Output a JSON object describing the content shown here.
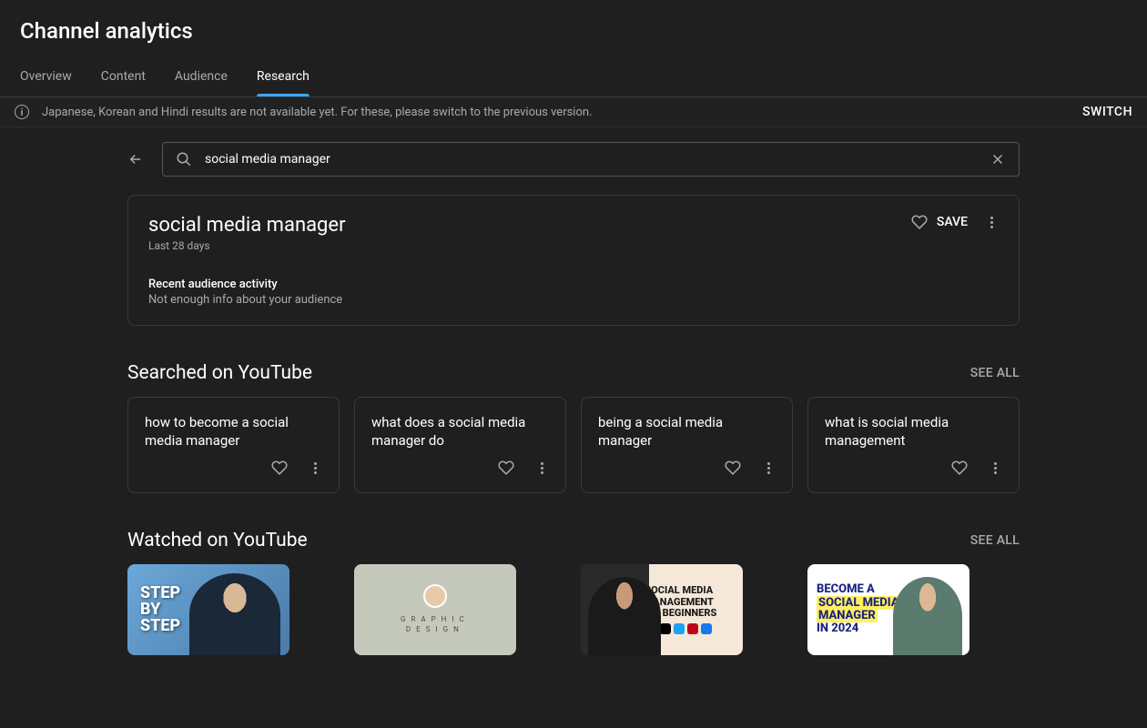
{
  "page_title": "Channel analytics",
  "tabs": [
    "Overview",
    "Content",
    "Audience",
    "Research"
  ],
  "notice": {
    "text": "Japanese, Korean and Hindi results are not available yet. For these, please switch to the previous version.",
    "switch": "SWITCH"
  },
  "search": {
    "value": "social media manager"
  },
  "result": {
    "title": "social media manager",
    "subtitle": "Last 28 days",
    "save": "SAVE",
    "activity_label": "Recent audience activity",
    "activity_info": "Not enough info about your audience"
  },
  "searched": {
    "title": "Searched on YouTube",
    "see_all": "SEE ALL",
    "items": [
      "how to become a social media manager",
      "what does a social media manager do",
      "being a social media manager",
      "what is social media management"
    ]
  },
  "watched": {
    "title": "Watched on YouTube",
    "see_all": "SEE ALL",
    "thumbs": {
      "t1_line1": "STEP",
      "t1_line2": "BY",
      "t1_line3": "STEP",
      "t2_line1": "GRAPHIC",
      "t2_line2": "DESIGN",
      "t3_line1": "SOCIAL MEDIA",
      "t3_line2": "MANAGEMENT",
      "t3_line3": "FOR BEGINNERS",
      "t4_line1": "BECOME A",
      "t4_line2": "SOCIAL MEDIA",
      "t4_line3": "MANAGER",
      "t4_line4": "IN 2024"
    }
  }
}
